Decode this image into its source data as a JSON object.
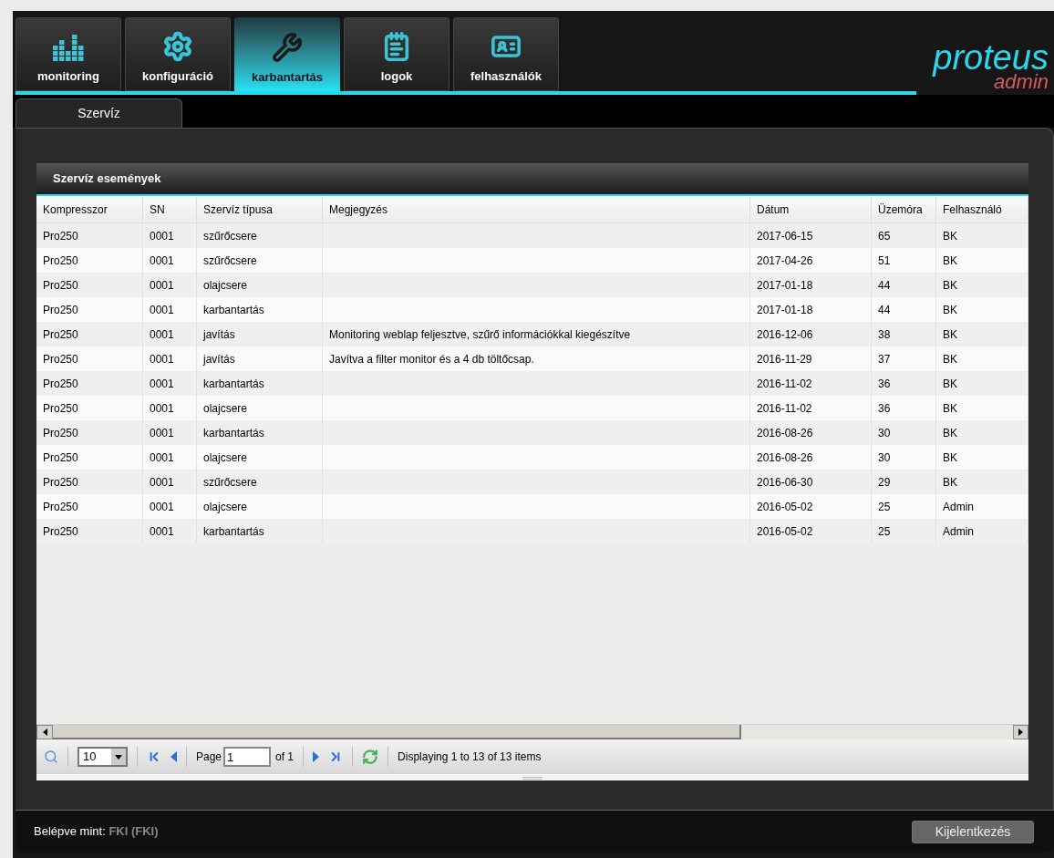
{
  "tabs": [
    {
      "label": "monitoring",
      "kind": "bars",
      "selected": false
    },
    {
      "label": "konfiguráció",
      "kind": "gear",
      "selected": false
    },
    {
      "label": "karbantartás",
      "kind": "tools",
      "selected": true
    },
    {
      "label": "logok",
      "kind": "notepad",
      "selected": false
    },
    {
      "label": "felhasználók",
      "kind": "badge",
      "selected": false
    }
  ],
  "logo": {
    "name": "proteus",
    "sub": "admin"
  },
  "subtabs": [
    {
      "label": "Szervíz",
      "selected": true
    }
  ],
  "grid": {
    "title": "Szervíz események",
    "columns": [
      "Kompresszor",
      "SN",
      "Szervíz típusa",
      "Megjegyzés",
      "Dátum",
      "Üzemóra",
      "Felhasználó"
    ],
    "rows": [
      [
        "Pro250",
        "0001",
        "szűrőcsere",
        "",
        "2017-06-15",
        "65",
        "BK"
      ],
      [
        "Pro250",
        "0001",
        "szűrőcsere",
        "",
        "2017-04-26",
        "51",
        "BK"
      ],
      [
        "Pro250",
        "0001",
        "olajcsere",
        "",
        "2017-01-18",
        "44",
        "BK"
      ],
      [
        "Pro250",
        "0001",
        "karbantartás",
        "",
        "2017-01-18",
        "44",
        "BK"
      ],
      [
        "Pro250",
        "0001",
        "javítás",
        "Monitoring weblap feljesztve, szűrő információkkal kiegészítve",
        "2016-12-06",
        "38",
        "BK"
      ],
      [
        "Pro250",
        "0001",
        "javítás",
        "Javítva a filter monitor és a 4 db töltőcsap.",
        "2016-11-29",
        "37",
        "BK"
      ],
      [
        "Pro250",
        "0001",
        "karbantartás",
        "",
        "2016-11-02",
        "36",
        "BK"
      ],
      [
        "Pro250",
        "0001",
        "olajcsere",
        "",
        "2016-11-02",
        "36",
        "BK"
      ],
      [
        "Pro250",
        "0001",
        "karbantartás",
        "",
        "2016-08-26",
        "30",
        "BK"
      ],
      [
        "Pro250",
        "0001",
        "olajcsere",
        "",
        "2016-08-26",
        "30",
        "BK"
      ],
      [
        "Pro250",
        "0001",
        "szűrőcsere",
        "",
        "2016-06-30",
        "29",
        "BK"
      ],
      [
        "Pro250",
        "0001",
        "olajcsere",
        "",
        "2016-05-02",
        "25",
        "Admin"
      ],
      [
        "Pro250",
        "0001",
        "karbantartás",
        "",
        "2016-05-02",
        "25",
        "Admin"
      ]
    ],
    "pager": {
      "page_size": "10",
      "page_label": "Page",
      "page": "1",
      "of": "of 1",
      "status": "Displaying 1 to 13 of 13 items"
    }
  },
  "footer": {
    "label": "Belépve mint:",
    "user": "FKI (FKI)",
    "logout": "Kijelentkezés"
  }
}
